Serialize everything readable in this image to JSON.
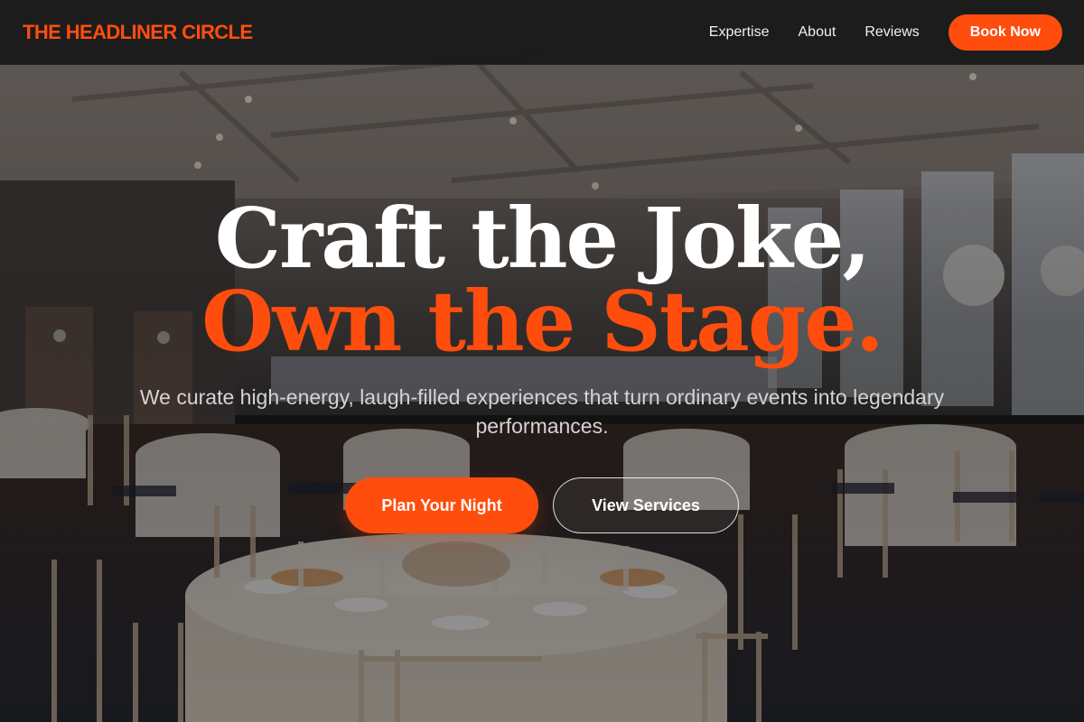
{
  "colors": {
    "accent": "#ff4d0d",
    "navbar_bg": "#181818",
    "headline_white": "#ffffff",
    "tagline": "#d4d4d4"
  },
  "navbar": {
    "brand": "THE HEADLINER CIRCLE",
    "links": [
      {
        "label": "Expertise"
      },
      {
        "label": "About"
      },
      {
        "label": "Reviews"
      }
    ],
    "cta_label": "Book Now"
  },
  "hero": {
    "background_image": "banquet-hall-photo",
    "headline_line1": "Craft the Joke,",
    "headline_line2": "Own the Stage.",
    "tagline": "We curate high-energy, laugh-filled experiences that turn ordinary events into legendary performances.",
    "primary_cta": "Plan Your Night",
    "secondary_cta": "View Services"
  }
}
